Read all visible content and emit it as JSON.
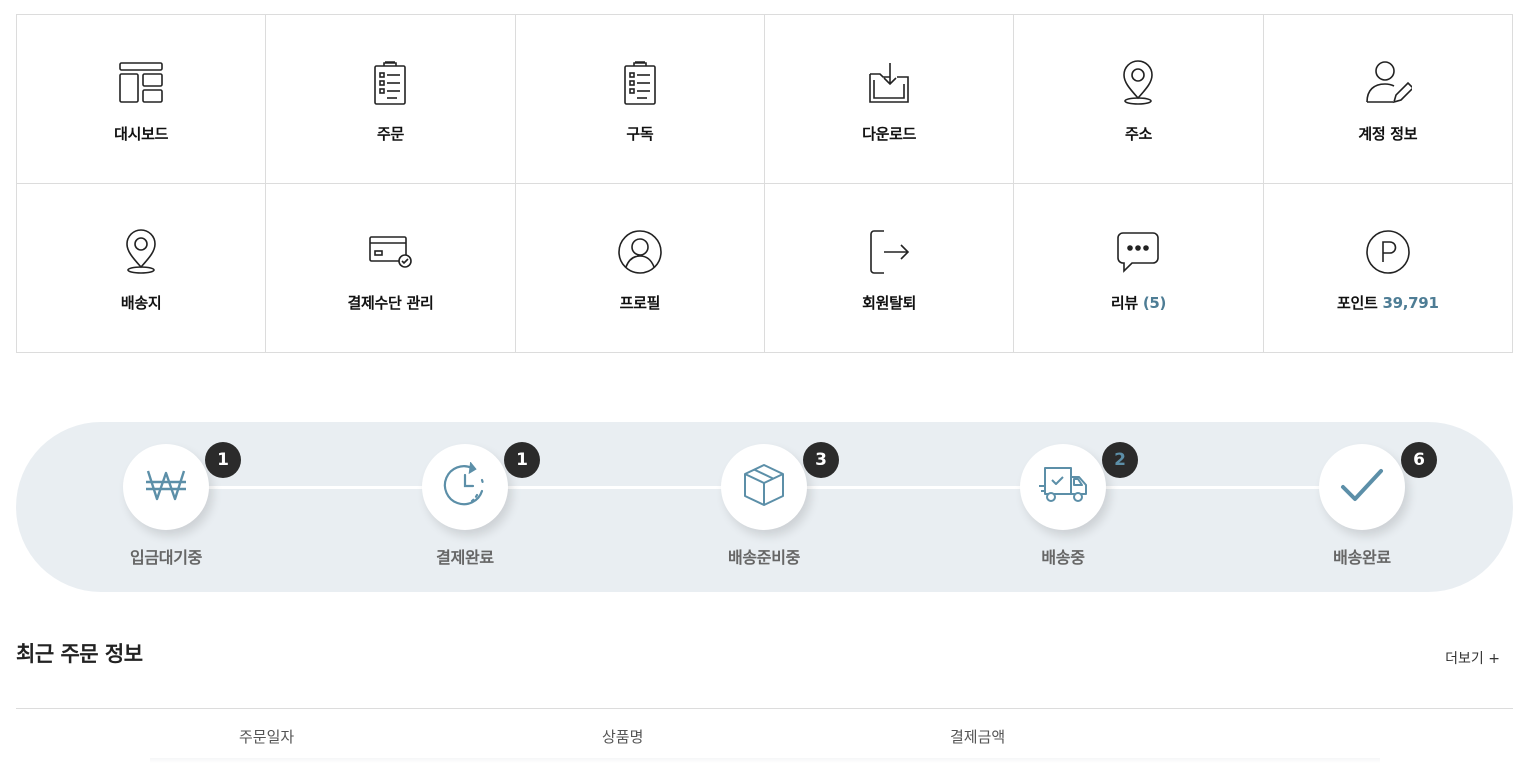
{
  "menu": {
    "items": [
      {
        "label": "대시보드",
        "icon": "dashboard-icon"
      },
      {
        "label": "주문",
        "icon": "clipboard-list-icon"
      },
      {
        "label": "구독",
        "icon": "clipboard-list-icon"
      },
      {
        "label": "다운로드",
        "icon": "download-folder-icon"
      },
      {
        "label": "주소",
        "icon": "map-pin-icon"
      },
      {
        "label": "계정 정보",
        "icon": "user-edit-icon"
      },
      {
        "label": "배송지",
        "icon": "map-pin-icon"
      },
      {
        "label": "결제수단 관리",
        "icon": "credit-card-check-icon"
      },
      {
        "label": "프로필",
        "icon": "user-circle-icon"
      },
      {
        "label": "회원탈퇴",
        "icon": "logout-icon"
      },
      {
        "label": "리뷰",
        "count": "(5)",
        "icon": "chat-bubble-icon"
      },
      {
        "label": "포인트",
        "count": "39,791",
        "icon": "point-icon"
      }
    ]
  },
  "order_status": {
    "steps": [
      {
        "label": "입금대기중",
        "count": "1",
        "icon": "won-icon"
      },
      {
        "label": "결제완료",
        "count": "1",
        "icon": "clock-refresh-icon"
      },
      {
        "label": "배송준비중",
        "count": "3",
        "icon": "box-icon"
      },
      {
        "label": "배송중",
        "count": "2",
        "icon": "truck-icon"
      },
      {
        "label": "배송완료",
        "count": "6",
        "icon": "check-icon"
      }
    ]
  },
  "recent_orders": {
    "title": "최근 주문 정보",
    "more_label": "더보기 +",
    "columns": [
      "주문일자",
      "상품명",
      "결제금액"
    ]
  },
  "colors": {
    "accent": "#4e7d95",
    "status_bg": "#e9eef2",
    "badge_bg": "#2b2b2b"
  }
}
